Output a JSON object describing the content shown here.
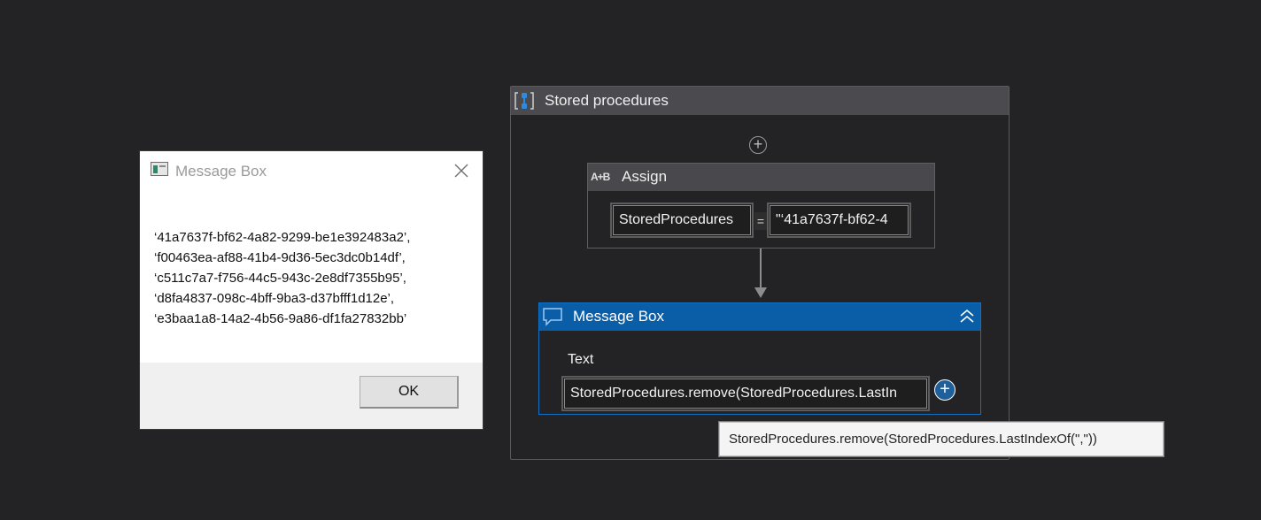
{
  "dialog": {
    "title": "Message Box",
    "close_icon": "close-icon",
    "lines": [
      "‘41a7637f-bf62-4a82-9299-be1e392483a2’,",
      "‘f00463ea-af88-41b4-9d36-5ec3dc0b14df’,",
      "‘c511c7a7-f756-44c5-943c-2e8df7355b95’,",
      "‘d8fa4837-098c-4bff-9ba3-d37bfff1d12e’,",
      "‘e3baa1a8-14a2-4b56-9a86-df1fa27832bb’"
    ],
    "ok_label": "OK"
  },
  "sequence": {
    "title": "Stored procedures",
    "add_icon": "plus-circle-icon",
    "assign": {
      "icon_text": "A+B",
      "title": "Assign",
      "to_value": "StoredProcedures",
      "equals": "=",
      "value": "\"‘41a7637f-bf62-4"
    },
    "message_box": {
      "title": "Message Box",
      "collapse_icon": "double-chevron-up-icon",
      "text_label": "Text",
      "text_value": "StoredProcedures.remove(StoredProcedures.LastIn",
      "add_argument_icon": "plus-circle-icon"
    }
  },
  "tooltip": {
    "text": "StoredProcedures.remove(StoredProcedures.LastIndexOf(\",\"))"
  },
  "colors": {
    "canvas_bg": "#232325",
    "activity_header": "#48484d",
    "selected_header": "#0a5ea8",
    "selected_border": "#1170c4"
  }
}
